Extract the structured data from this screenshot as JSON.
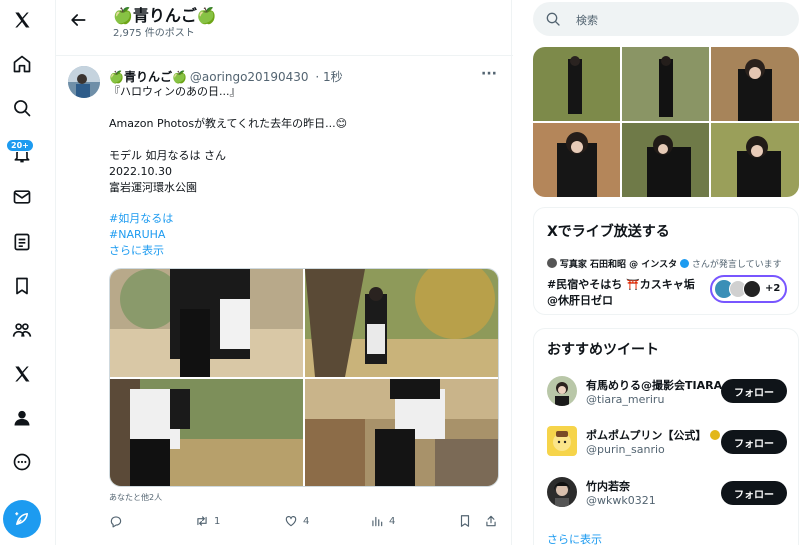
{
  "nav": {
    "badge": "20+",
    "icons": [
      "x-logo-icon",
      "home-icon",
      "search-icon",
      "notifications-icon",
      "messages-icon",
      "lists-icon",
      "bookmarks-icon",
      "communities-icon",
      "premium-x-icon",
      "profile-icon",
      "more-icon",
      "compose-icon"
    ]
  },
  "header": {
    "title": "🍏青りんご🍏",
    "subtitle": "2,975 件のポスト"
  },
  "tweet": {
    "name": "🍏青りんご🍏",
    "handle": "@aoringo20190430",
    "time": "· 1秒",
    "lines": [
      "『ハロウィンのあの日...』",
      "Amazon Photosが教えてくれた去年の昨日...😊",
      "モデル 如月なるは さん",
      "2022.10.30",
      "富岩運河環水公園"
    ],
    "hashtags": [
      "#如月なるは",
      "#NARUHA"
    ],
    "show_more": "さらに表示",
    "liked_by": "あなたと他2人",
    "actions": {
      "reply": "",
      "retweet": "1",
      "like": "4",
      "views": "4"
    }
  },
  "sidebar": {
    "search_placeholder": "検索",
    "live": {
      "title": "Xでライブ放送する",
      "host": "写真家 石田和昭 @ インスタ",
      "host_suffix": "さんが発言しています",
      "space_line1": "#民宿やそはち ⛩️カスキャ垢",
      "space_line2": "@休肝日ゼロ",
      "listeners_extra": "+2"
    },
    "recommend": {
      "title": "おすすめツイート",
      "users": [
        {
          "name": "有馬めりる@撮影会TIARA",
          "handle": "@tiara_meriru",
          "follow": "フォロー"
        },
        {
          "name": "ポムポムプリン【公式】",
          "handle": "@purin_sanrio",
          "follow": "フォロー"
        },
        {
          "name": "竹内若奈",
          "handle": "@wkwk0321",
          "follow": "フォロー"
        }
      ],
      "show_more": "さらに表示"
    }
  }
}
